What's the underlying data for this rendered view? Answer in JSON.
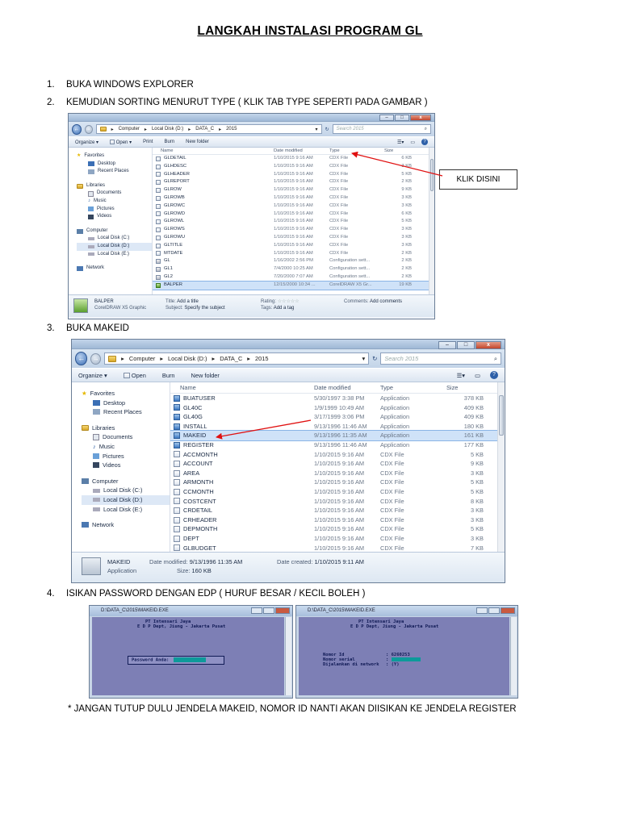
{
  "document": {
    "title": "LANGKAH INSTALASI PROGRAM GL",
    "steps": [
      {
        "num": "1.",
        "text": "BUKA WINDOWS EXPLORER"
      },
      {
        "num": "2.",
        "text": "KEMUDIAN SORTING MENURUT TYPE ( KLIK TAB TYPE SEPERTI PADA GAMBAR )"
      },
      {
        "num": "3.",
        "text": "BUKA MAKEID"
      },
      {
        "num": "4.",
        "text": "ISIKAN PASSWORD DENGAN EDP ( HURUF BESAR / KECIL BOLEH )"
      }
    ],
    "note": "* JANGAN TUTUP DULU JENDELA MAKEID, NOMOR ID NANTI AKAN DIISIKAN KE JENDELA REGISTER",
    "callout": "KLIK DISINI"
  },
  "explorer1": {
    "path": [
      "Computer",
      "Local Disk (D:)",
      "DATA_C",
      "2015"
    ],
    "search_placeholder": "Search 2015",
    "toolbar": {
      "organize": "Organize",
      "open": "Open",
      "print": "Print",
      "burn": "Burn",
      "new_folder": "New folder"
    },
    "nav": {
      "favorites": "Favorites",
      "desktop": "Desktop",
      "recent": "Recent Places",
      "libraries": "Libraries",
      "documents": "Documents",
      "music": "Music",
      "pictures": "Pictures",
      "videos": "Videos",
      "computer": "Computer",
      "c": "Local Disk (C:)",
      "d": "Local Disk (D:)",
      "e": "Local Disk (E:)",
      "network": "Network"
    },
    "columns": {
      "name": "Name",
      "date": "Date modified",
      "type": "Type",
      "size": "Size"
    },
    "files": [
      {
        "name": "GLDETAIL",
        "date": "1/10/2015 9:16 AM",
        "type": "CDX File",
        "size": "6 KB"
      },
      {
        "name": "GLHDESC",
        "date": "1/10/2015 9:16 AM",
        "type": "CDX File",
        "size": "3 KB"
      },
      {
        "name": "GLHEADER",
        "date": "1/10/2015 9:16 AM",
        "type": "CDX File",
        "size": "5 KB"
      },
      {
        "name": "GLREPORT",
        "date": "1/10/2015 9:16 AM",
        "type": "CDX File",
        "size": "2 KB"
      },
      {
        "name": "GLROW",
        "date": "1/10/2015 9:16 AM",
        "type": "CDX File",
        "size": "9 KB"
      },
      {
        "name": "GLROWB",
        "date": "1/10/2015 9:16 AM",
        "type": "CDX File",
        "size": "3 KB"
      },
      {
        "name": "GLROWC",
        "date": "1/10/2015 9:16 AM",
        "type": "CDX File",
        "size": "3 KB"
      },
      {
        "name": "GLROWD",
        "date": "1/10/2015 9:16 AM",
        "type": "CDX File",
        "size": "6 KB"
      },
      {
        "name": "GLROWL",
        "date": "1/10/2015 9:16 AM",
        "type": "CDX File",
        "size": "5 KB"
      },
      {
        "name": "GLROWS",
        "date": "1/10/2015 9:16 AM",
        "type": "CDX File",
        "size": "3 KB"
      },
      {
        "name": "GLROWU",
        "date": "1/10/2015 9:16 AM",
        "type": "CDX File",
        "size": "3 KB"
      },
      {
        "name": "GLTITLE",
        "date": "1/10/2015 9:16 AM",
        "type": "CDX File",
        "size": "3 KB"
      },
      {
        "name": "MTDATE",
        "date": "1/10/2015 9:16 AM",
        "type": "CDX File",
        "size": "2 KB"
      },
      {
        "name": "GL",
        "date": "1/16/2002 2:56 PM",
        "type": "Configuration sett...",
        "size": "2 KB"
      },
      {
        "name": "GL1",
        "date": "7/4/2000 10:25 AM",
        "type": "Configuration sett...",
        "size": "2 KB"
      },
      {
        "name": "GL2",
        "date": "7/20/2000 7:07 AM",
        "type": "Configuration sett...",
        "size": "2 KB"
      },
      {
        "name": "BALPER",
        "date": "12/15/2000 10:34 ...",
        "type": "CorelDRAW X5 Gr...",
        "size": "19 KB"
      }
    ],
    "details": {
      "name": "BALPER",
      "kind": "CorelDRAW X5 Graphic",
      "title_label": "Title:",
      "title_val": "Add a title",
      "subject_label": "Subject:",
      "subject_val": "Specify the subject",
      "rating_label": "Rating:",
      "tags_label": "Tags:",
      "tags_val": "Add a tag",
      "comments_label": "Comments:",
      "comments_val": "Add comments"
    }
  },
  "explorer2": {
    "path": [
      "Computer",
      "Local Disk (D:)",
      "DATA_C",
      "2015"
    ],
    "search_placeholder": "Search 2015",
    "toolbar": {
      "organize": "Organize",
      "open": "Open",
      "burn": "Burn",
      "new_folder": "New folder"
    },
    "files": [
      {
        "name": "BUATUSER",
        "date": "5/30/1997 3:38 PM",
        "type": "Application",
        "size": "378 KB"
      },
      {
        "name": "GL40C",
        "date": "1/9/1999 10:49 AM",
        "type": "Application",
        "size": "409 KB"
      },
      {
        "name": "GL40G",
        "date": "3/17/1999 3:06 PM",
        "type": "Application",
        "size": "409 KB"
      },
      {
        "name": "INSTALL",
        "date": "9/13/1996 11:46 AM",
        "type": "Application",
        "size": "180 KB"
      },
      {
        "name": "MAKEID",
        "date": "9/13/1996 11:35 AM",
        "type": "Application",
        "size": "161 KB"
      },
      {
        "name": "REGISTER",
        "date": "9/13/1996 11:46 AM",
        "type": "Application",
        "size": "177 KB"
      },
      {
        "name": "ACCMONTH",
        "date": "1/10/2015 9:16 AM",
        "type": "CDX File",
        "size": "5 KB"
      },
      {
        "name": "ACCOUNT",
        "date": "1/10/2015 9:16 AM",
        "type": "CDX File",
        "size": "9 KB"
      },
      {
        "name": "AREA",
        "date": "1/10/2015 9:16 AM",
        "type": "CDX File",
        "size": "3 KB"
      },
      {
        "name": "ARMONTH",
        "date": "1/10/2015 9:16 AM",
        "type": "CDX File",
        "size": "5 KB"
      },
      {
        "name": "CCMONTH",
        "date": "1/10/2015 9:16 AM",
        "type": "CDX File",
        "size": "5 KB"
      },
      {
        "name": "COSTCENT",
        "date": "1/10/2015 9:16 AM",
        "type": "CDX File",
        "size": "8 KB"
      },
      {
        "name": "CRDETAIL",
        "date": "1/10/2015 9:16 AM",
        "type": "CDX File",
        "size": "3 KB"
      },
      {
        "name": "CRHEADER",
        "date": "1/10/2015 9:16 AM",
        "type": "CDX File",
        "size": "3 KB"
      },
      {
        "name": "DEPMONTH",
        "date": "1/10/2015 9:16 AM",
        "type": "CDX File",
        "size": "5 KB"
      },
      {
        "name": "DEPT",
        "date": "1/10/2015 9:16 AM",
        "type": "CDX File",
        "size": "3 KB"
      },
      {
        "name": "GLBUDGET",
        "date": "1/10/2015 9:16 AM",
        "type": "CDX File",
        "size": "7 KB"
      }
    ],
    "details": {
      "name": "MAKEID",
      "kind": "Application",
      "modified_label": "Date modified:",
      "modified_val": "9/13/1996 11:35 AM",
      "created_label": "Date created:",
      "created_val": "1/10/2015 9:11 AM",
      "size_label": "Size:",
      "size_val": "160 KB"
    }
  },
  "dos1": {
    "title": "D:\\DATA_C\\2015\\MAKEID.EXE",
    "line1": "PT Intensari Jaya",
    "line2": "E D P Dept, Jiung - Jakarta Pusat",
    "password_label": "Password Anda:"
  },
  "dos2": {
    "title": "D:\\DATA_C\\2015\\MAKEID.EXE",
    "line1": "PT Intensari Jaya",
    "line2": "E D P Dept, Jiung - Jakarta Pusat",
    "r1_label": "Nomor Id",
    "r1_val": ": 6260253",
    "r2_label": "Nomor serial",
    "r2_val": ":",
    "r3_label": "Dijalankan di network",
    "r3_val": ": (Y)"
  }
}
